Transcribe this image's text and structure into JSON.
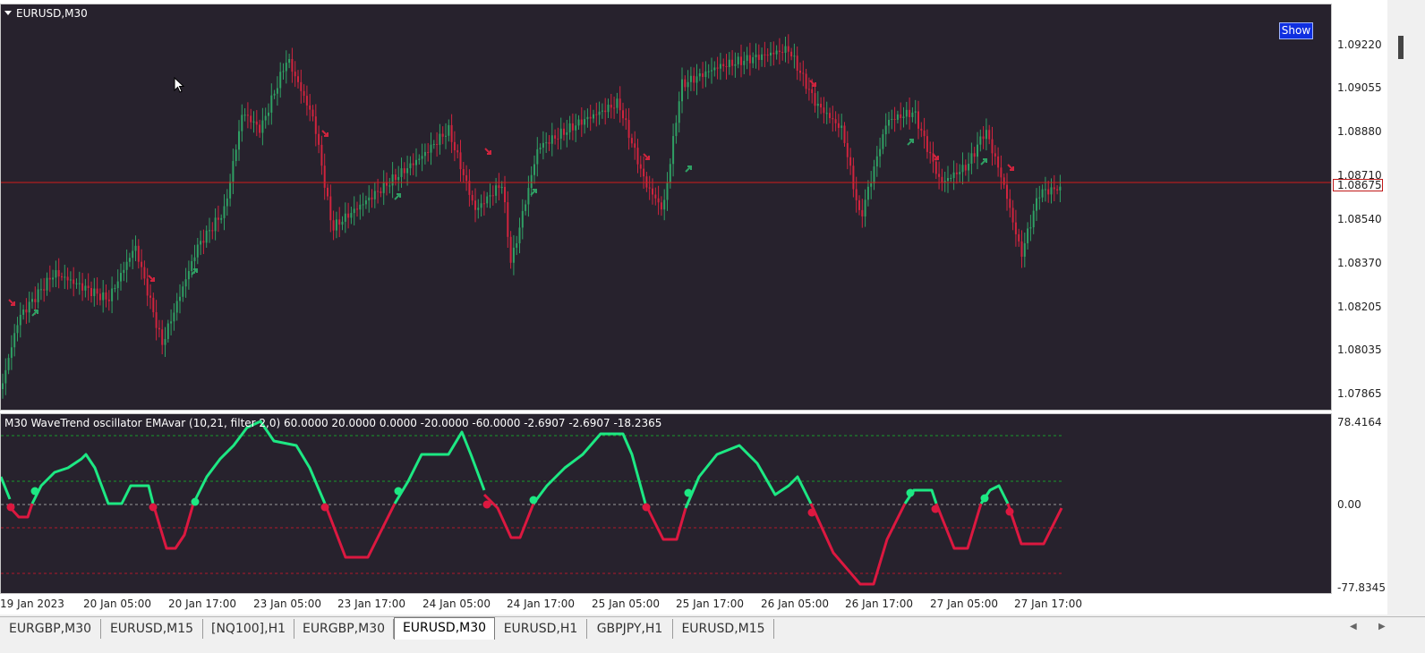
{
  "main_chart": {
    "title": "EURUSD,M30",
    "show_button": "Show",
    "price_labels": [
      "1.09220",
      "1.09055",
      "1.08880",
      "1.08710",
      "1.08540",
      "1.08370",
      "1.08205",
      "1.08035",
      "1.07865"
    ],
    "current_price": "1.08675",
    "colors": {
      "background": "#27222d",
      "bull": "#2fa064",
      "bear": "#d0243e",
      "current_line": "#d01c1c"
    }
  },
  "oscillator": {
    "title": "M30 WaveTrend oscillator EMAvar (10,21, filter 2,0) 60.0000 20.0000 0.0000 -20.0000 -60.0000 -2.6907 -2.6907 -18.2365",
    "scale_labels": [
      "78.4164",
      "0.00",
      "-77.8345"
    ],
    "colors": {
      "up": "#1de883",
      "down": "#dc1840",
      "level_outer": "#1a9a2a",
      "level_zero": "#9a9a9a",
      "level_low": "#b0182a"
    }
  },
  "time_axis": [
    "19 Jan 2023",
    "20 Jan 05:00",
    "20 Jan 17:00",
    "23 Jan 05:00",
    "23 Jan 17:00",
    "24 Jan 05:00",
    "24 Jan 17:00",
    "25 Jan 05:00",
    "25 Jan 17:00",
    "26 Jan 05:00",
    "26 Jan 17:00",
    "27 Jan 05:00",
    "27 Jan 17:00"
  ],
  "tabs": [
    {
      "label": "EURGBP,M30",
      "active": false
    },
    {
      "label": "EURUSD,M15",
      "active": false
    },
    {
      "label": "[NQ100],H1",
      "active": false
    },
    {
      "label": "EURGBP,M30",
      "active": false
    },
    {
      "label": "EURUSD,M30",
      "active": true
    },
    {
      "label": "EURUSD,H1",
      "active": false
    },
    {
      "label": "GBPJPY,H1",
      "active": false
    },
    {
      "label": "EURUSD,M15",
      "active": false
    }
  ],
  "scroll": {
    "left": "◀",
    "right": "▶"
  }
}
